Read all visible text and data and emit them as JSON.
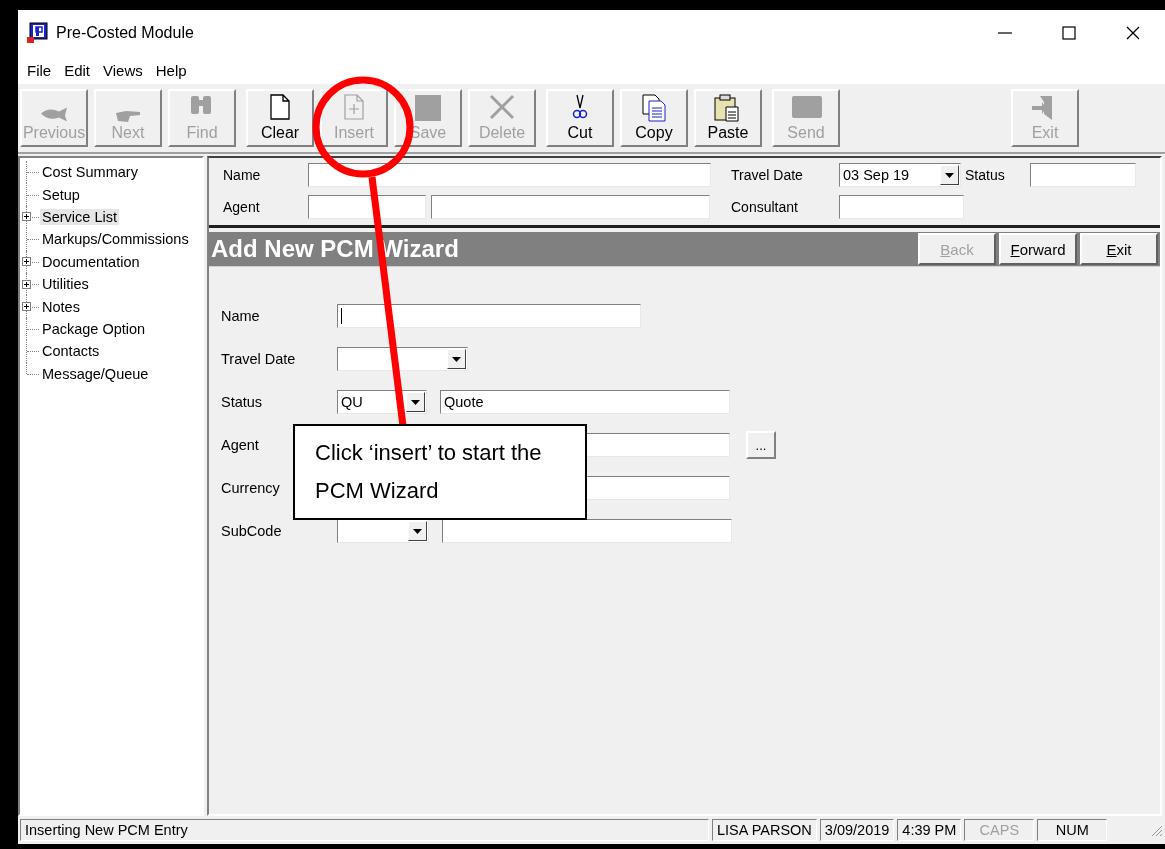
{
  "window": {
    "title": "Pre-Costed Module"
  },
  "menu": [
    "File",
    "Edit",
    "Views",
    "Help"
  ],
  "toolbar_groups": [
    {
      "buttons": [
        {
          "label": "Previous",
          "disabled": true
        },
        {
          "label": "Next",
          "disabled": true
        },
        {
          "label": "Find",
          "disabled": true
        }
      ]
    },
    {
      "buttons": [
        {
          "label": "Clear",
          "disabled": false
        },
        {
          "label": "Insert",
          "disabled": true
        },
        {
          "label": "Save",
          "disabled": true
        },
        {
          "label": "Delete",
          "disabled": true
        }
      ]
    },
    {
      "buttons": [
        {
          "label": "Cut",
          "disabled": false
        },
        {
          "label": "Copy",
          "disabled": false
        },
        {
          "label": "Paste",
          "disabled": false
        }
      ]
    },
    {
      "buttons": [
        {
          "label": "Send",
          "disabled": true
        }
      ]
    },
    {
      "buttons": [
        {
          "label": "Exit",
          "disabled": true
        }
      ]
    }
  ],
  "tree": [
    {
      "label": "Cost Summary",
      "expandable": false,
      "selected": false
    },
    {
      "label": "Setup",
      "expandable": false,
      "selected": false
    },
    {
      "label": "Service List",
      "expandable": true,
      "selected": true
    },
    {
      "label": "Markups/Commissions",
      "expandable": false,
      "selected": false
    },
    {
      "label": "Documentation",
      "expandable": true,
      "selected": false
    },
    {
      "label": "Utilities",
      "expandable": true,
      "selected": false
    },
    {
      "label": "Notes",
      "expandable": true,
      "selected": false
    },
    {
      "label": "Package Option",
      "expandable": false,
      "selected": false
    },
    {
      "label": "Contacts",
      "expandable": false,
      "selected": false
    },
    {
      "label": "Message/Queue",
      "expandable": false,
      "selected": false
    }
  ],
  "header": {
    "name_label": "Name",
    "agent_label": "Agent",
    "travel_date_label": "Travel Date",
    "travel_date": "03 Sep 19",
    "status_label": "Status",
    "consultant_label": "Consultant"
  },
  "wizard": {
    "title": "Add New PCM Wizard",
    "buttons": [
      {
        "accel": "B",
        "rest": "ack",
        "disabled": true
      },
      {
        "accel": "F",
        "rest": "orward",
        "disabled": false
      },
      {
        "accel": "E",
        "rest": "xit",
        "disabled": false
      }
    ],
    "name_label": "Name",
    "travel_date_label": "Travel Date",
    "status_label": "Status",
    "status_code": "QU",
    "status_text": "Quote",
    "agent_label": "Agent",
    "agent_button": "...",
    "currency_label": "Currency",
    "subcode_label": "SubCode"
  },
  "status_bar": [
    {
      "text": "Inserting New PCM Entry",
      "on": true
    },
    {
      "text": "LISA PARSON",
      "on": true
    },
    {
      "text": "3/09/2019",
      "on": true
    },
    {
      "text": "4:39 PM",
      "on": true
    },
    {
      "text": "CAPS",
      "on": false
    },
    {
      "text": "NUM",
      "on": true
    }
  ],
  "callout": {
    "text": "Click ‘insert’ to start the PCM Wizard"
  }
}
